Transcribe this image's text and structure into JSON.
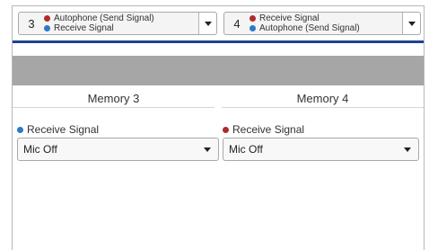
{
  "selectors": [
    {
      "number": "3",
      "line1": "Autophone (Send Signal)",
      "line1_color": "#b22a2a",
      "line2": "Receive Signal",
      "line2_color": "#2f78c8"
    },
    {
      "number": "4",
      "line1": "Receive Signal",
      "line1_color": "#b22a2a",
      "line2": "Autophone (Send Signal)",
      "line2_color": "#2f78c8"
    }
  ],
  "columns": [
    {
      "header": "Memory 3",
      "label": "Receive Signal",
      "label_dot_color": "#2f78c8",
      "dropdown_value": "Mic Off"
    },
    {
      "header": "Memory 4",
      "label": "Receive Signal",
      "label_dot_color": "#b22a2a",
      "dropdown_value": "Mic Off"
    }
  ],
  "colors": {
    "accent_line": "#1f3f94",
    "band": "#a6a6a6"
  },
  "icons": {
    "dropdown": "chevron-down-icon",
    "status_dot": "dot-icon"
  }
}
